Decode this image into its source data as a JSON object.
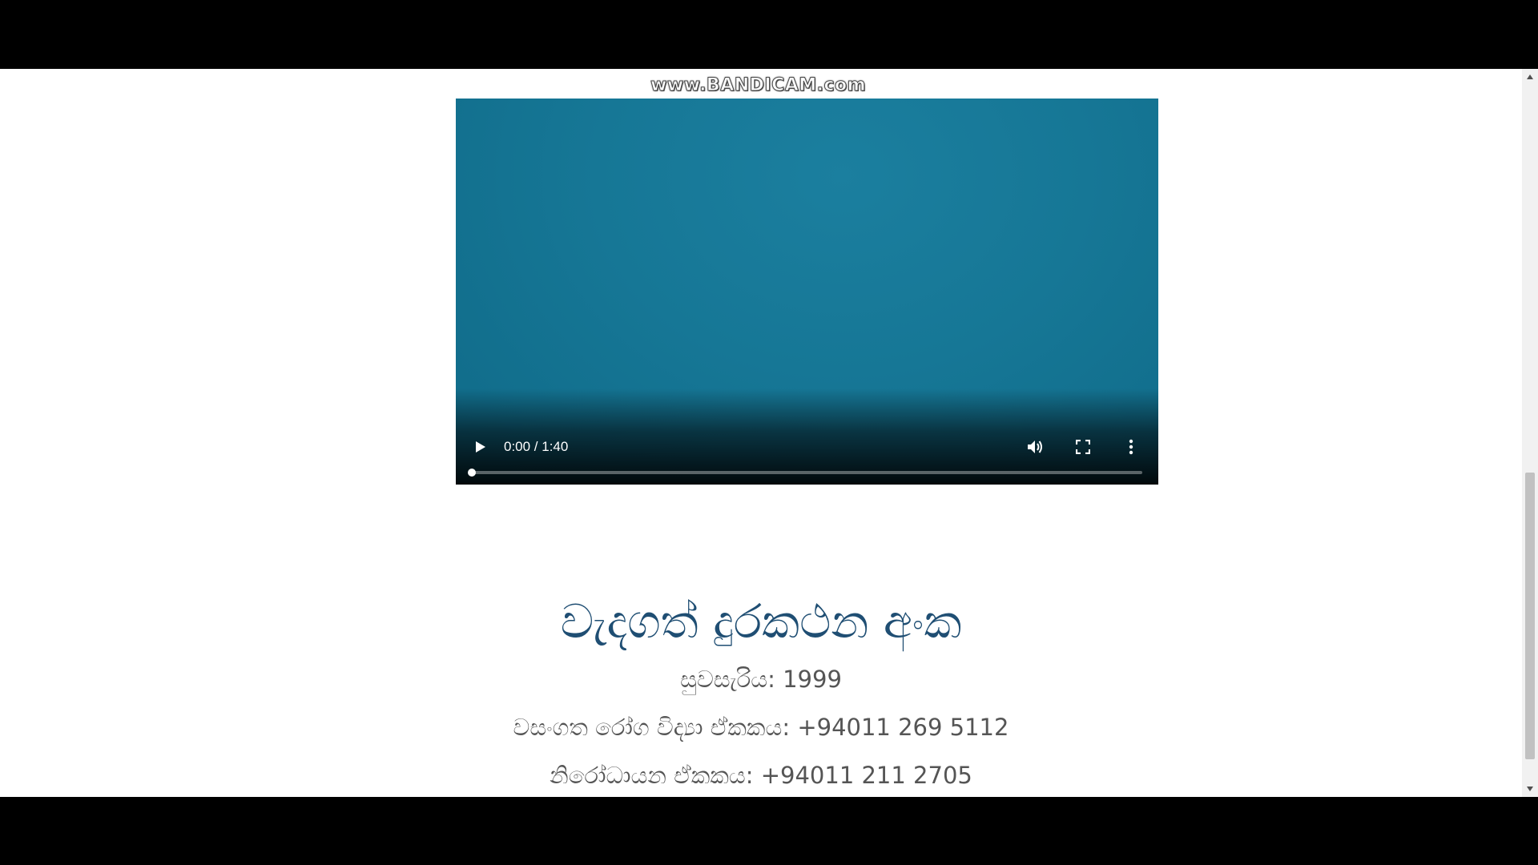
{
  "watermark": {
    "text": "www.BANDICAM.com"
  },
  "video": {
    "time_display": "0:00 / 1:40",
    "progress": 0.0,
    "play_icon": "play-icon",
    "volume_icon": "volume-icon",
    "fullscreen_icon": "fullscreen-icon",
    "more_icon": "more-options-icon"
  },
  "section": {
    "title": "වැදගත් දුරකථන අංක",
    "contacts": [
      "සුවසැරිය: 1999",
      "වසංගත රෝග විද්‍යා ඒකකය: +94011 269 5112",
      "නිරෝධායන ඒකකය: +94011 211 2705"
    ]
  },
  "colors": {
    "video_background": "#167796",
    "heading": "#1f4e73",
    "body_text": "#555555",
    "page_background": "#ffffff",
    "letterbox": "#000000"
  }
}
